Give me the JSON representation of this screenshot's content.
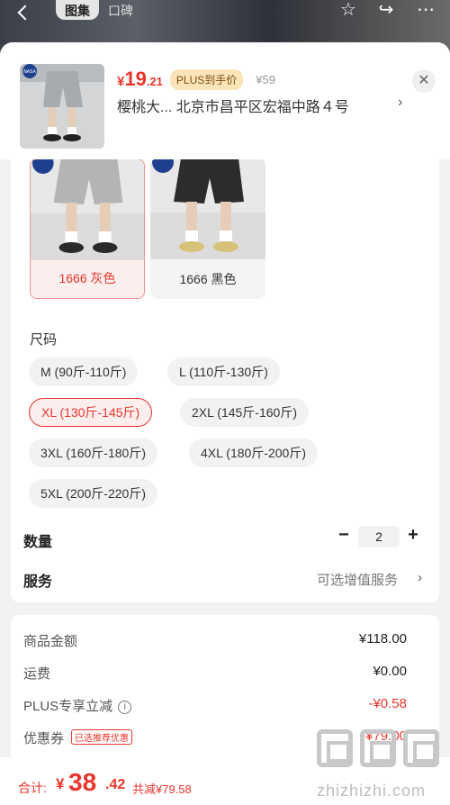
{
  "background": {
    "tabs": [
      {
        "label": "图集"
      },
      {
        "label": "口碑"
      }
    ],
    "icons": [
      "back-icon",
      "star-icon",
      "share-icon",
      "more-icon"
    ]
  },
  "header": {
    "price_currency": "¥",
    "price_integer": "19",
    "price_decimal": ".21",
    "plus_badge": "PLUS到手价",
    "original_price": "¥59",
    "address": "樱桃大...  北京市昌平区宏福中路４号",
    "thumb_logo_text": "NASA"
  },
  "colors": {
    "options": [
      {
        "label": "1666 灰色",
        "selected": true
      },
      {
        "label": "1666 黑色",
        "selected": false
      }
    ]
  },
  "sizes": {
    "title": "尺码",
    "options": [
      {
        "label": "M (90斤-110斤)",
        "selected": false
      },
      {
        "label": "L (110斤-130斤)",
        "selected": false
      },
      {
        "label": "XL (130斤-145斤)",
        "selected": true
      },
      {
        "label": "2XL (145斤-160斤)",
        "selected": false
      },
      {
        "label": "3XL (160斤-180斤)",
        "selected": false
      },
      {
        "label": "4XL (180斤-200斤)",
        "selected": false
      },
      {
        "label": "5XL (200斤-220斤)",
        "selected": false
      }
    ]
  },
  "quantity": {
    "label": "数量",
    "minus": "−",
    "value": "2",
    "plus": "+"
  },
  "service": {
    "label": "服务",
    "value": "可选增值服务"
  },
  "summary": {
    "rows": [
      {
        "label": "商品金额",
        "value": "¥118.00"
      },
      {
        "label": "运费",
        "value": "¥0.00"
      },
      {
        "label": "PLUS专享立减",
        "value": "-¥0.58"
      },
      {
        "label": "优惠券",
        "tag": "已选推荐优惠",
        "value": "-¥79.00"
      }
    ]
  },
  "footer": {
    "total_label": "合计:",
    "total_currency": "¥",
    "total_integer": "38",
    "total_decimal": ".42",
    "saved": "共减¥79.58"
  },
  "watermark": {
    "text": "zhizhizhi.com"
  },
  "theme": {
    "accent": "#e8352b",
    "plus_bg": "#fbe5b8"
  }
}
